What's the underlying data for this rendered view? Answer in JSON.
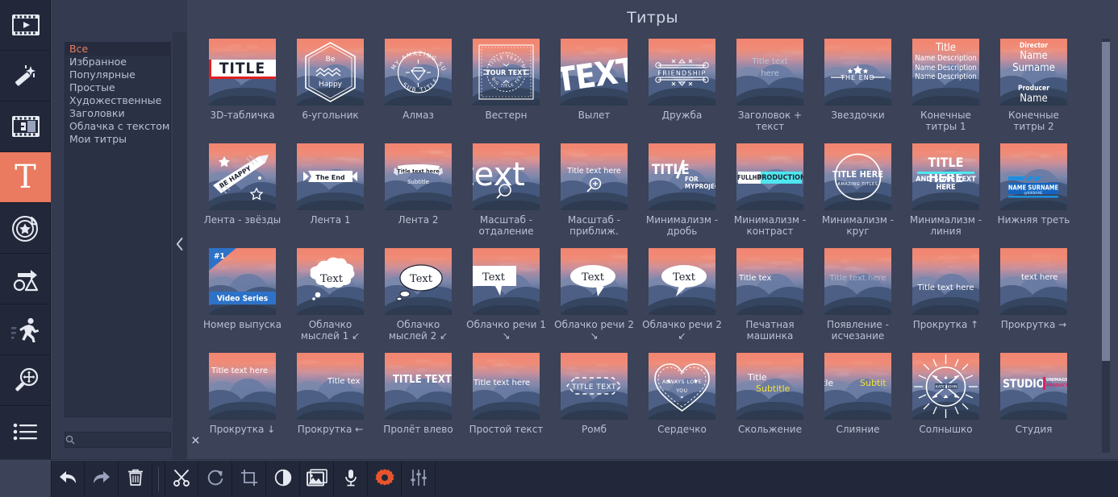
{
  "header": {
    "title": "Титры"
  },
  "rail": {
    "items": [
      {
        "name": "import-media",
        "icon": "film-play-icon",
        "active": false
      },
      {
        "name": "effects-wand",
        "icon": "magic-wand-icon",
        "active": false
      },
      {
        "name": "transitions",
        "icon": "transition-icon",
        "active": false
      },
      {
        "name": "titles",
        "icon": "text-t-icon",
        "active": true
      },
      {
        "name": "stickers",
        "icon": "sticker-star-icon",
        "active": false
      },
      {
        "name": "callouts",
        "icon": "shapes-arrow-icon",
        "active": false
      },
      {
        "name": "animation",
        "icon": "running-man-icon",
        "active": false
      },
      {
        "name": "pan-and-zoom",
        "icon": "magnifier-move-icon",
        "active": false
      },
      {
        "name": "more-tools",
        "icon": "list-lines-icon",
        "active": false
      }
    ]
  },
  "categories": {
    "selected": "Все",
    "items": [
      "Все",
      "Избранное",
      "Популярные",
      "Простые",
      "Художественные",
      "Заголовки",
      "Облачка с текстом",
      "Мои титры"
    ]
  },
  "search": {
    "value": "",
    "placeholder": "",
    "icon": "search-icon",
    "clear_icon": "close-x-icon"
  },
  "collapse": {
    "icon": "chevron-left-icon"
  },
  "scrollbar": {
    "orientation": "vertical",
    "thumb_position_pct": 1,
    "thumb_size_pct": 77
  },
  "grid": {
    "items": [
      {
        "label": "3D-табличка",
        "preview": "TITLE"
      },
      {
        "label": "6-угольник",
        "preview": "Be Happy"
      },
      {
        "label": "Алмаз",
        "preview": "MY AMAZING SUMMER / SUB TITLE"
      },
      {
        "label": "Вестерн",
        "preview": "TITLE TEXT HERE / YOUR TEXT / BIG TITLE TEXT HERE"
      },
      {
        "label": "Вылет",
        "preview": "TEXT"
      },
      {
        "label": "Дружба",
        "preview": "FRIENDSHIP"
      },
      {
        "label": "Заголовок + текст",
        "preview": "Title text here"
      },
      {
        "label": "Звездочки",
        "preview": "THE END"
      },
      {
        "label": "Конечные титры 1",
        "preview": "Title / Name Description / Name Description / Name Description"
      },
      {
        "label": "Конечные титры 2",
        "preview": "Director / Name Surname / Producer / Name Surname"
      },
      {
        "label": "Лента - звёзды",
        "preview": "BE HAPPY"
      },
      {
        "label": "Лента 1",
        "preview": "The End"
      },
      {
        "label": "Лента 2",
        "preview": "Title text here / Subtitle"
      },
      {
        "label": "Масштаб - отдаление",
        "preview": "text"
      },
      {
        "label": "Масштаб - приближ.",
        "preview": "Title text here"
      },
      {
        "label": "Минимализм - дробь",
        "preview": "TITLE / FOR MYPROJECT"
      },
      {
        "label": "Минимализм - контраст",
        "preview": "FULLHD PRODUCTION"
      },
      {
        "label": "Минимализм - круг",
        "preview": "TITLE HERE / AMAZING TITLES"
      },
      {
        "label": "Минимализм - линия",
        "preview": "TITLE HERE / AND SOME TEXT HERE"
      },
      {
        "label": "Нижняя треть",
        "preview": "NAME SURNAME / @NIKNAME"
      },
      {
        "label": "Номер выпуска",
        "preview": "#1 / Video Series"
      },
      {
        "label": "Облачко мыслей 1 ↙",
        "preview": "Text"
      },
      {
        "label": "Облачко мыслей 2 ↙",
        "preview": "Text"
      },
      {
        "label": "Облачко речи 1 ↘",
        "preview": "Text"
      },
      {
        "label": "Облачко речи 2 ↘",
        "preview": "Text"
      },
      {
        "label": "Облачко речи 2 ↙",
        "preview": "Text"
      },
      {
        "label": "Печатная машинка",
        "preview": "Title tex"
      },
      {
        "label": "Появление - исчезание",
        "preview": "Title text here"
      },
      {
        "label": "Прокрутка ↑",
        "preview": "Title text here"
      },
      {
        "label": "Прокрутка →",
        "preview": "text here"
      },
      {
        "label": "Прокрутка ↓",
        "preview": "Title text here"
      },
      {
        "label": "Прокрутка ←",
        "preview": "Title tex"
      },
      {
        "label": "Пролёт влево",
        "preview": "TITLE TEXT H"
      },
      {
        "label": "Простой текст",
        "preview": "Title text here"
      },
      {
        "label": "Ромб",
        "preview": "TITLE TEXT"
      },
      {
        "label": "Сердечко",
        "preview": "ALWAYS LOVE / YOU"
      },
      {
        "label": "Скольжение",
        "preview": "Title / Subtitle"
      },
      {
        "label": "Слияние",
        "preview": "itle   Subtit"
      },
      {
        "label": "Солнышко",
        "preview": "KATE / JOHN"
      },
      {
        "label": "Студия",
        "preview": "STUDIO UNIMAGINABLE PRODUCTION"
      }
    ]
  },
  "toolbar": {
    "buttons": [
      {
        "name": "undo-button",
        "icon": "undo-arrow-icon",
        "accent": false
      },
      {
        "name": "redo-button",
        "icon": "redo-arrow-icon",
        "accent": false
      },
      {
        "name": "delete-button",
        "icon": "trash-icon",
        "accent": false
      },
      {
        "name": "split-button",
        "icon": "scissors-icon",
        "accent": false
      },
      {
        "name": "rotate-button",
        "icon": "rotate-icon",
        "accent": false
      },
      {
        "name": "crop-button",
        "icon": "crop-icon",
        "accent": false
      },
      {
        "name": "color-button",
        "icon": "contrast-circle-icon",
        "accent": false
      },
      {
        "name": "image-button",
        "icon": "picture-icon",
        "accent": false
      },
      {
        "name": "audio-button",
        "icon": "microphone-icon",
        "accent": false
      },
      {
        "name": "properties-button",
        "icon": "gear-icon",
        "accent": true
      },
      {
        "name": "equalizer-button",
        "icon": "sliders-icon",
        "accent": false
      }
    ]
  },
  "colors": {
    "accent": "#ea7a60",
    "panel_bg": "#343b50",
    "rail_bg": "#222839",
    "canvas_bg": "#3c4257",
    "text": "#b9c1d4",
    "gear_accent": "#e8552d"
  }
}
